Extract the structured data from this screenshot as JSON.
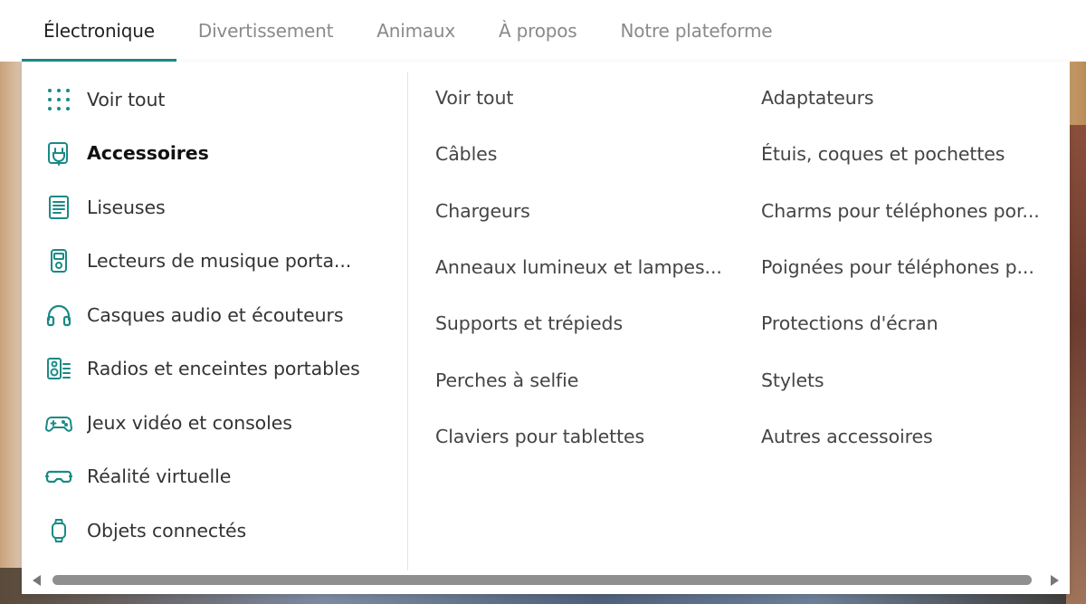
{
  "tabs": [
    {
      "label": "Électronique",
      "active": true
    },
    {
      "label": "Divertissement",
      "active": false
    },
    {
      "label": "Animaux",
      "active": false
    },
    {
      "label": "À propos",
      "active": false
    },
    {
      "label": "Notre plateforme",
      "active": false
    }
  ],
  "categories": [
    {
      "label": "Voir tout",
      "icon": "grid-dots-icon"
    },
    {
      "label": "Accessoires",
      "icon": "plug-icon",
      "selected": true
    },
    {
      "label": "Liseuses",
      "icon": "ereader-icon"
    },
    {
      "label": "Lecteurs de musique porta...",
      "icon": "music-player-icon"
    },
    {
      "label": "Casques audio et écouteurs",
      "icon": "headphones-icon"
    },
    {
      "label": "Radios et enceintes portables",
      "icon": "speaker-icon"
    },
    {
      "label": "Jeux vidéo et consoles",
      "icon": "gamepad-icon"
    },
    {
      "label": "Réalité virtuelle",
      "icon": "vr-headset-icon"
    },
    {
      "label": "Objets connectés",
      "icon": "smartwatch-icon"
    }
  ],
  "subcategories_col1": [
    "Voir tout",
    "Câbles",
    "Chargeurs",
    "Anneaux lumineux et lampes...",
    "Supports et trépieds",
    "Perches à selfie",
    "Claviers pour tablettes"
  ],
  "subcategories_col2": [
    "Adaptateurs",
    "Étuis, coques et pochettes",
    "Charms pour téléphones por...",
    "Poignées pour téléphones p...",
    "Protections d'écran",
    "Stylets",
    "Autres accessoires"
  ],
  "colors": {
    "accent": "#1a8a86",
    "text": "#333333",
    "muted": "#8a8a8a"
  }
}
